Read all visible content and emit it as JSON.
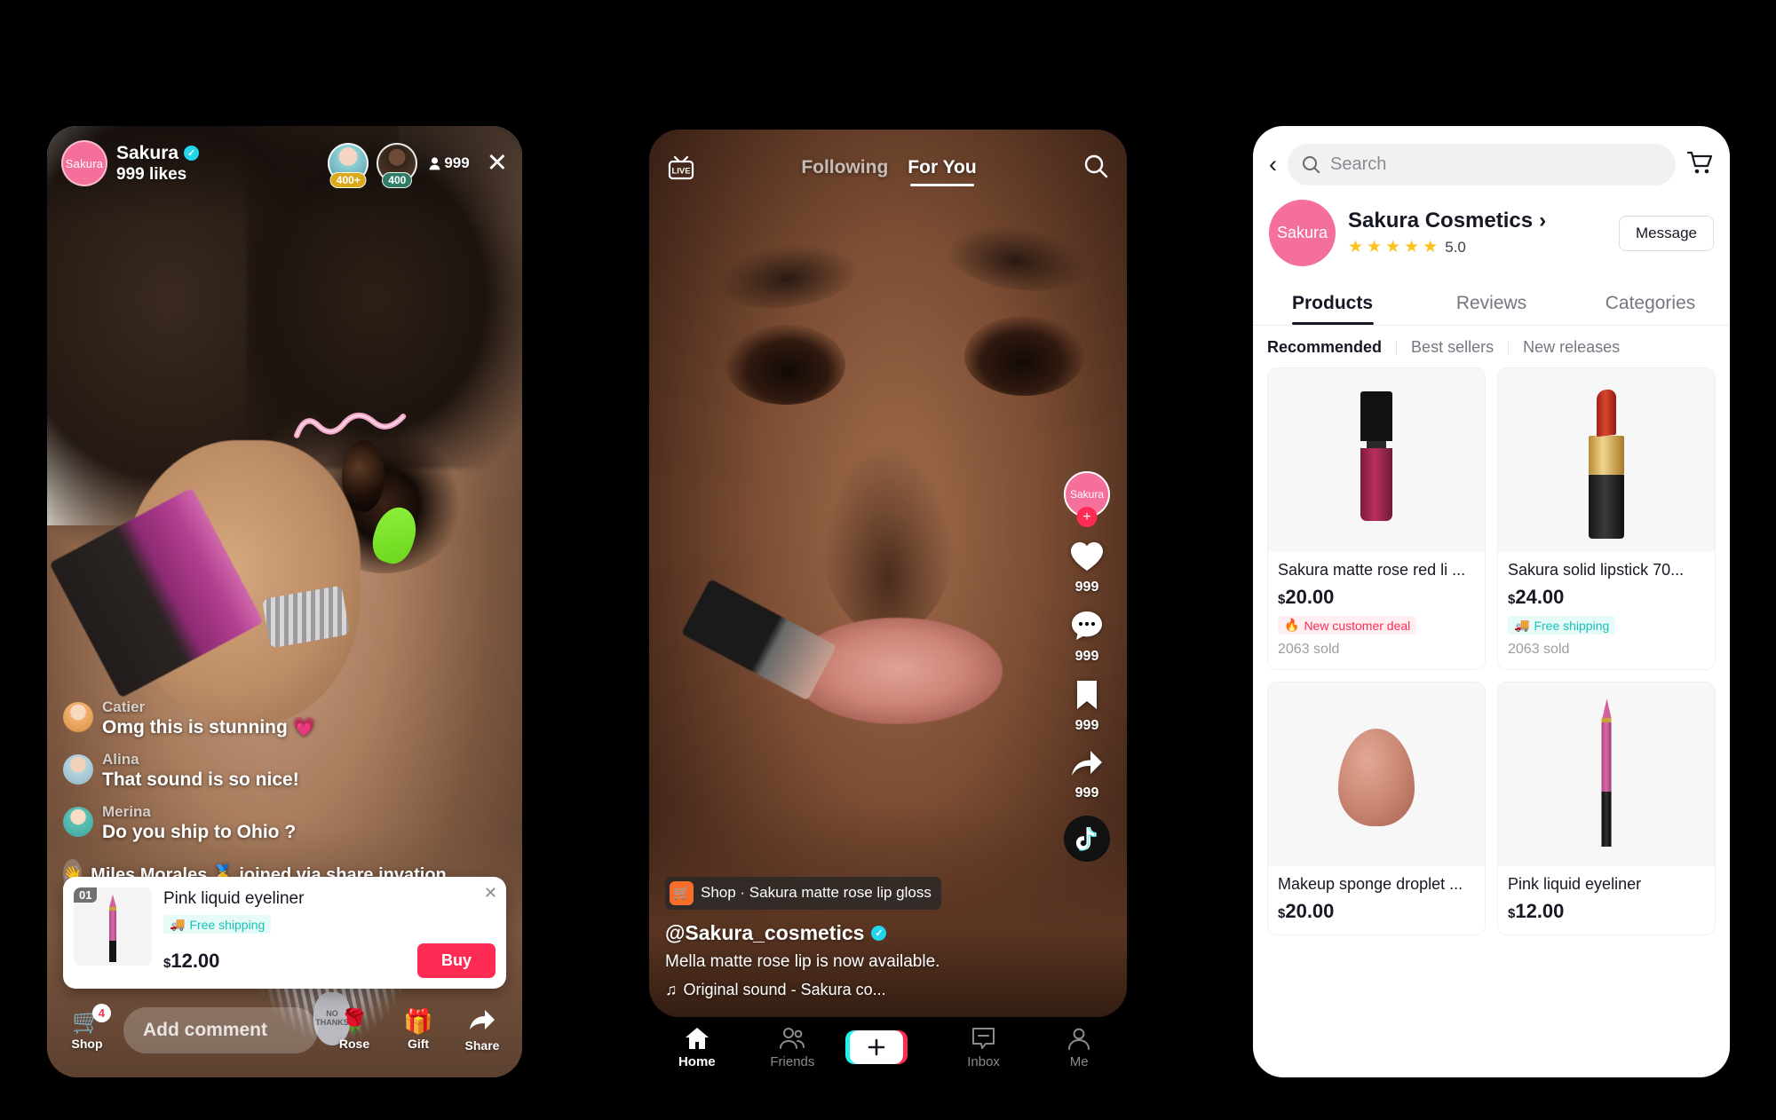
{
  "live": {
    "host": {
      "name": "Sakura",
      "avatar_label": "Sakura",
      "likes": "999 likes",
      "verified_icon": "verified-check"
    },
    "viewers": {
      "count": "999",
      "icon": "person-icon"
    },
    "top_viewers": [
      {
        "badge": "400+",
        "color": "#d9a91b"
      },
      {
        "badge": "400",
        "color": "#2f7d66"
      }
    ],
    "close_icon": "close-icon",
    "comments": [
      {
        "user": "Catier",
        "text": "Omg this is stunning 💗"
      },
      {
        "user": "Alina",
        "text": "That sound is so nice!"
      },
      {
        "user": "Merina",
        "text": "Do you ship to Ohio ?"
      }
    ],
    "join_event": {
      "icon": "wave-hand-icon",
      "text": "Miles Morales 🥇 joined via share invation"
    },
    "product_card": {
      "index": "01",
      "title": "Pink liquid eyeliner",
      "badge": "Free shipping",
      "badge_icon": "truck-icon",
      "price": "12.00",
      "currency": "$",
      "buy_label": "Buy",
      "close_icon": "close-icon"
    },
    "bottom_bar": {
      "shop": {
        "label": "Shop",
        "icon": "cart-icon",
        "badge": "4"
      },
      "comment_placeholder": "Add comment",
      "rose": {
        "label": "Rose",
        "icon": "rose-icon"
      },
      "gift": {
        "label": "Gift",
        "icon": "gift-icon"
      },
      "share": {
        "label": "Share",
        "icon": "share-arrow-icon"
      }
    }
  },
  "feed": {
    "live_icon": "live-tv-icon",
    "tabs": [
      {
        "label": "Following",
        "active": false
      },
      {
        "label": "For You",
        "active": true
      }
    ],
    "search_icon": "search-icon",
    "rail": {
      "profile_label": "Sakura",
      "follow_icon": "plus-icon",
      "like": {
        "icon": "heart-icon",
        "count": "999"
      },
      "comment": {
        "icon": "comment-icon",
        "count": "999"
      },
      "bookmark": {
        "icon": "bookmark-icon",
        "count": "999"
      },
      "share": {
        "icon": "share-arrow-icon",
        "count": "999"
      },
      "disc_icon": "tiktok-note-icon"
    },
    "shop_chip": {
      "icon": "cart-icon",
      "text": "Shop · Sakura matte rose lip gloss"
    },
    "username": "@Sakura_cosmetics",
    "verified_icon": "verified-check",
    "description": "Mella matte rose lip is now available.",
    "sound": {
      "icon": "music-note-icon",
      "text": "Original sound - Sakura co..."
    },
    "nav": [
      {
        "label": "Home",
        "icon": "home-icon",
        "active": true
      },
      {
        "label": "Friends",
        "icon": "friends-icon",
        "active": false
      },
      {
        "label": "",
        "icon": "create-plus-icon",
        "active": false
      },
      {
        "label": "Inbox",
        "icon": "inbox-icon",
        "active": false
      },
      {
        "label": "Me",
        "icon": "profile-icon",
        "active": false
      }
    ]
  },
  "shop": {
    "back_icon": "chevron-left-icon",
    "search": {
      "placeholder": "Search",
      "icon": "search-icon"
    },
    "cart_icon": "cart-icon",
    "store": {
      "logo_label": "Sakura",
      "name": "Sakura Cosmetics",
      "chevron_icon": "chevron-right-icon",
      "rating": "5.0",
      "stars": 5,
      "message_label": "Message"
    },
    "tabs": [
      {
        "label": "Products",
        "active": true
      },
      {
        "label": "Reviews",
        "active": false
      },
      {
        "label": "Categories",
        "active": false
      }
    ],
    "subtabs": [
      {
        "label": "Recommended",
        "active": true
      },
      {
        "label": "Best sellers",
        "active": false
      },
      {
        "label": "New releases",
        "active": false
      }
    ],
    "products": [
      {
        "name": "Sakura matte rose red li ...",
        "currency": "$",
        "price": "20.00",
        "badge": "New customer deal",
        "badge_icon": "fire-icon",
        "badge_type": "deal",
        "sold": "2063 sold",
        "art": "gloss"
      },
      {
        "name": "Sakura solid lipstick 70...",
        "currency": "$",
        "price": "24.00",
        "badge": "Free shipping",
        "badge_icon": "truck-icon",
        "badge_type": "ship",
        "sold": "2063 sold",
        "art": "lipstick"
      },
      {
        "name": "Makeup sponge droplet ...",
        "currency": "$",
        "price": "20.00",
        "badge": "",
        "badge_icon": "",
        "badge_type": "",
        "sold": "",
        "art": "sponge"
      },
      {
        "name": "Pink liquid eyeliner",
        "currency": "$",
        "price": "12.00",
        "badge": "",
        "badge_icon": "",
        "badge_type": "",
        "sold": "",
        "art": "eyeliner"
      }
    ]
  }
}
